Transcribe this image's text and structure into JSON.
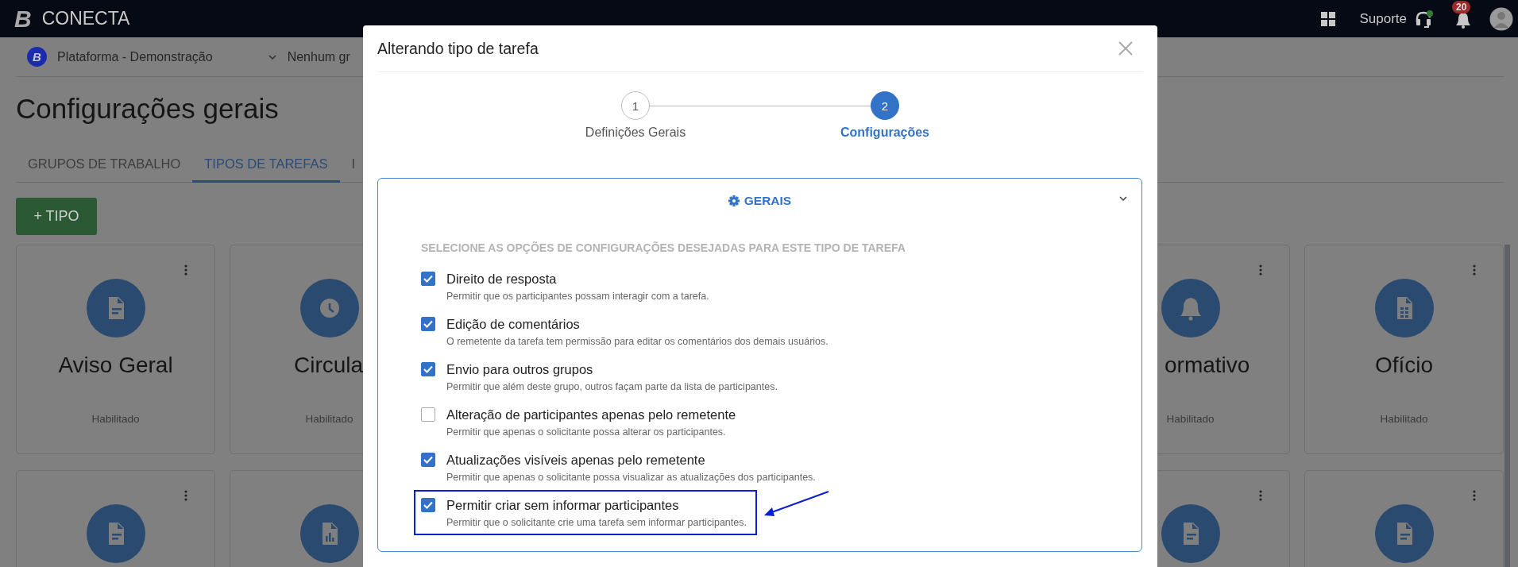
{
  "topbar": {
    "logo_letter": "B",
    "brand": "CONECTA",
    "support_label": "Suporte",
    "support_online": true,
    "notification_count": "20"
  },
  "context_bar": {
    "logo_letter": "B",
    "platform": "Plataforma - Demonstração",
    "group": "Nenhum gr"
  },
  "page_title": "Configurações gerais",
  "tabs": [
    {
      "label": "GRUPOS DE TRABALHO",
      "selected": false
    },
    {
      "label": "TIPOS DE TAREFAS",
      "selected": true
    },
    {
      "label": "I",
      "selected": false
    }
  ],
  "add_button": "+ TIPO",
  "left_cards": [
    {
      "title": "Aviso Geral",
      "status": "Habilitado",
      "kind": "document",
      "menu": true
    },
    {
      "title": "Circula",
      "status": "Habilitado",
      "kind": "clock"
    },
    {
      "kind": "document",
      "menu": true
    },
    {
      "kind": "chart"
    }
  ],
  "right_cards": [
    {
      "title": "ormativo",
      "status": "Habilitado",
      "kind": "bell",
      "menu": true
    },
    {
      "title": "Ofício",
      "status": "Habilitado",
      "kind": "spreadsheet",
      "menu": true
    },
    {
      "kind": "document",
      "menu": true
    },
    {
      "kind": "document",
      "menu": true
    }
  ],
  "modal": {
    "title": "Alterando tipo de tarefa",
    "steps": [
      {
        "number": "1",
        "label": "Definições Gerais",
        "selected": false
      },
      {
        "number": "2",
        "label": "Configurações",
        "selected": true
      }
    ],
    "section": {
      "title": "GERAIS",
      "expanded": true,
      "instruction": "SELECIONE AS OPÇÕES DE CONFIGURAÇÕES DESEJADAS PARA ESTE TIPO DE TAREFA",
      "options": [
        {
          "label": "Direito de resposta",
          "description": "Permitir que os participantes possam interagir com a tarefa.",
          "checked": true,
          "highlighted": false
        },
        {
          "label": "Edição de comentários",
          "description": "O remetente da tarefa tem permissão para editar os comentários dos demais usuários.",
          "checked": true,
          "highlighted": false
        },
        {
          "label": "Envio para outros grupos",
          "description": "Permitir que além deste grupo, outros façam parte da lista de participantes.",
          "checked": true,
          "highlighted": false
        },
        {
          "label": "Alteração de participantes apenas pelo remetente",
          "description": "Permitir que apenas o solicitante possa alterar os participantes.",
          "checked": false,
          "highlighted": false
        },
        {
          "label": "Atualizações visíveis apenas pelo remetente",
          "description": "Permitir que apenas o solicitante possa visualizar as atualizações dos participantes.",
          "checked": true,
          "highlighted": false
        },
        {
          "label": "Permitir criar sem informar participantes",
          "description": "Permitir que o solicitante crie uma tarefa sem informar participantes.",
          "checked": true,
          "highlighted": true
        }
      ]
    }
  }
}
